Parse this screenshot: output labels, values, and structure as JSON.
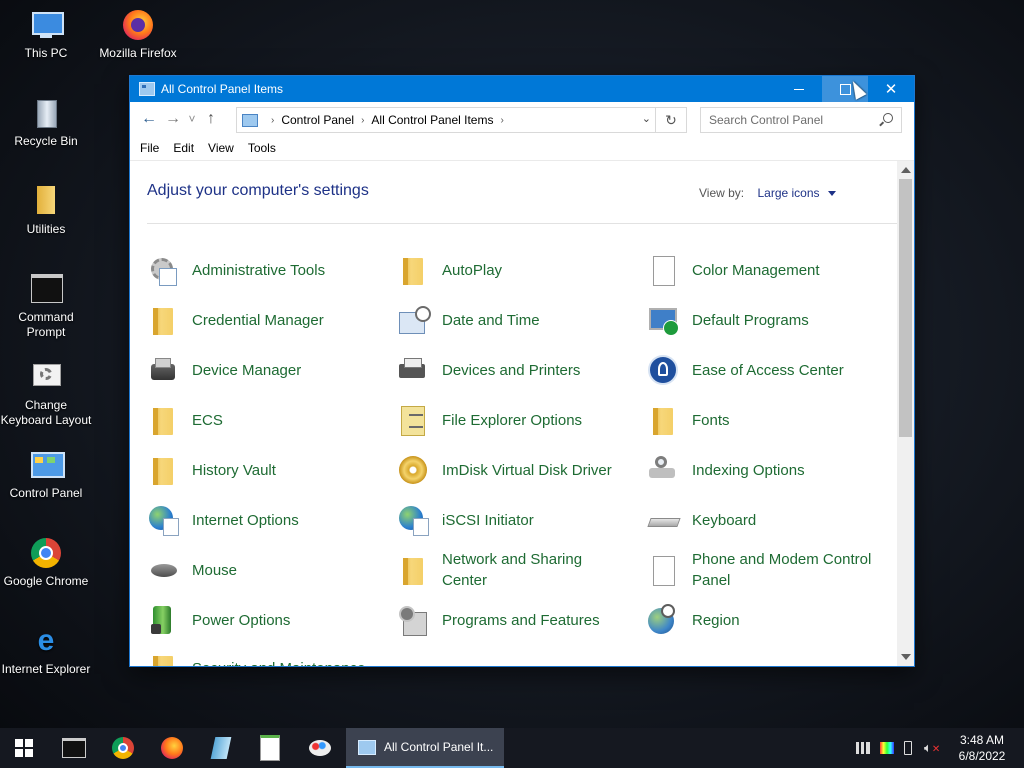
{
  "desktop": {
    "icons": [
      {
        "label": "This PC"
      },
      {
        "label": "Mozilla Firefox"
      },
      {
        "label": "Recycle Bin"
      },
      {
        "label": "Utilities"
      },
      {
        "label": "Command Prompt"
      },
      {
        "label": "Change Keyboard Layout"
      },
      {
        "label": "Control Panel"
      },
      {
        "label": "Google Chrome"
      },
      {
        "label": "Internet Explorer"
      }
    ]
  },
  "window": {
    "title": "All Control Panel Items",
    "breadcrumb": [
      "Control Panel",
      "All Control Panel Items"
    ],
    "search_placeholder": "Search Control Panel",
    "menu": [
      "File",
      "Edit",
      "View",
      "Tools"
    ],
    "heading": "Adjust your computer's settings",
    "view_by_label": "View by:",
    "view_by_value": "Large icons",
    "items": [
      {
        "label": "Administrative Tools",
        "icon": "admin-tools-icon"
      },
      {
        "label": "AutoPlay",
        "icon": "folder-icon"
      },
      {
        "label": "Color Management",
        "icon": "page-icon"
      },
      {
        "label": "Credential Manager",
        "icon": "folder-icon"
      },
      {
        "label": "Date and Time",
        "icon": "calendar-clock-icon"
      },
      {
        "label": "Default Programs",
        "icon": "default-programs-icon"
      },
      {
        "label": "Device Manager",
        "icon": "device-manager-icon"
      },
      {
        "label": "Devices and Printers",
        "icon": "printer-icon"
      },
      {
        "label": "Ease of Access Center",
        "icon": "accessibility-icon"
      },
      {
        "label": "ECS",
        "icon": "folder-icon"
      },
      {
        "label": "File Explorer Options",
        "icon": "folder-options-icon"
      },
      {
        "label": "Fonts",
        "icon": "folder-icon"
      },
      {
        "label": "History Vault",
        "icon": "folder-icon"
      },
      {
        "label": "ImDisk Virtual Disk Driver",
        "icon": "disc-icon"
      },
      {
        "label": "Indexing Options",
        "icon": "indexing-icon"
      },
      {
        "label": "Internet Options",
        "icon": "globe-icon"
      },
      {
        "label": "iSCSI Initiator",
        "icon": "globe-icon"
      },
      {
        "label": "Keyboard",
        "icon": "keyboard-icon"
      },
      {
        "label": "Mouse",
        "icon": "mouse-icon"
      },
      {
        "label": "Network and Sharing Center",
        "icon": "folder-icon"
      },
      {
        "label": "Phone and Modem Control Panel",
        "icon": "page-icon"
      },
      {
        "label": "Power Options",
        "icon": "battery-icon"
      },
      {
        "label": "Programs and Features",
        "icon": "programs-icon"
      },
      {
        "label": "Region",
        "icon": "region-globe-icon"
      },
      {
        "label": "Security and Maintenance",
        "icon": "flag-icon"
      }
    ]
  },
  "taskbar": {
    "active_window_label": "All Control Panel It...",
    "time": "3:48 AM",
    "date": "6/8/2022"
  }
}
